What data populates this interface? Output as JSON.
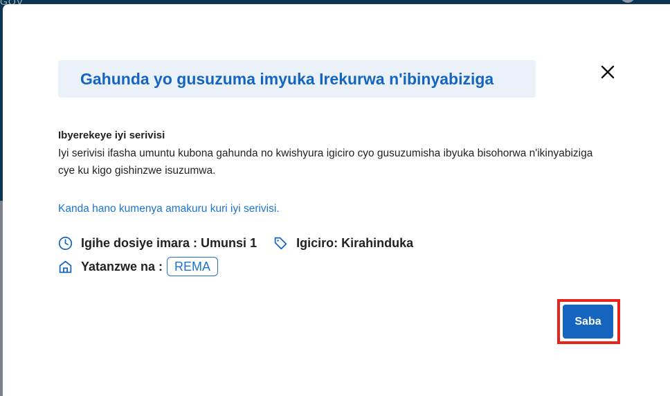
{
  "backdrop": {
    "logo_text": "GOV"
  },
  "modal": {
    "title": "Gahunda yo gusuzuma imyuka Irekurwa n'ibinyabiziga",
    "section_heading": "Ibyerekeye iyi serivisi",
    "description": "Iyi serivisi ifasha umuntu kubona gahunda no kwishyura igiciro cyo gusuzumisha ibyuka bisohorwa n'ikinyabiziga cye ku kigo gishinzwe isuzumwa.",
    "info_link": "Kanda hano kumenya amakuru kuri iyi serivisi.",
    "processing_time": "Igihe dosiye imara : Umunsi 1",
    "price": "Igiciro: Kirahinduka",
    "provider_label": "Yatanzwe na :",
    "provider_name": "REMA",
    "primary_button": "Saba"
  },
  "icons": {
    "clock": "clock-icon",
    "tag": "tag-icon",
    "home": "home-icon",
    "close": "close-icon"
  },
  "colors": {
    "accent": "#1565c0",
    "link": "#1a73d1",
    "title_bg": "#ebf1f8",
    "highlight": "#e8231a"
  }
}
